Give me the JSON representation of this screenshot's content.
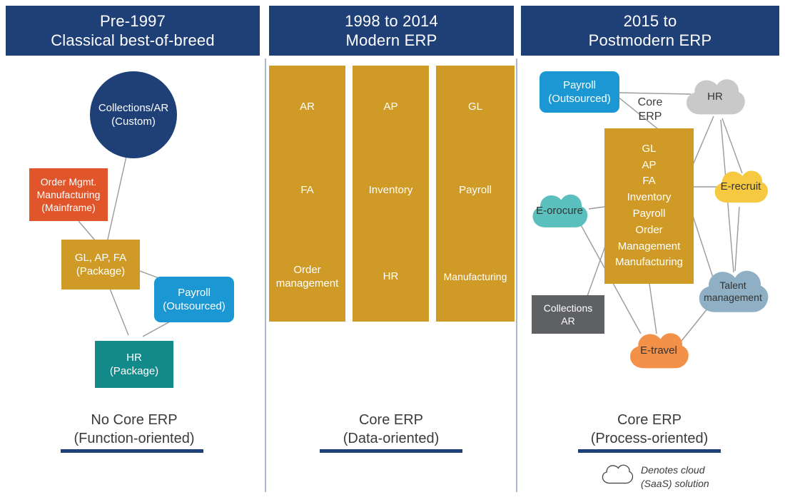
{
  "columns": [
    {
      "id": "pre-1997",
      "header": {
        "line1": "Pre-1997",
        "line2": "Classical best-of-breed"
      },
      "caption": {
        "line1": "No Core ERP",
        "line2": "(Function-oriented)"
      },
      "nodes": [
        {
          "name": "collections-ar-custom",
          "line1": "Collections/AR",
          "line2": "(Custom)",
          "color": "#1f3f77",
          "shape": "circle"
        },
        {
          "name": "order-mgmt-manufacturing-mainframe",
          "line1": "Order Mgmt.",
          "line2": "Manufacturing",
          "line3": "(Mainframe)",
          "color": "#e0562a",
          "shape": "sharp"
        },
        {
          "name": "gl-ap-fa-package",
          "line1": "GL, AP, FA",
          "line2": "(Package)",
          "color": "#cf9b26",
          "shape": "sharp"
        },
        {
          "name": "payroll-outsourced",
          "line1": "Payroll",
          "line2": "(Outsourced)",
          "color": "#1b97d4",
          "shape": "rounded"
        },
        {
          "name": "hr-package",
          "line1": "HR",
          "line2": "(Package)",
          "color": "#128a8a",
          "shape": "sharp"
        }
      ]
    },
    {
      "id": "1998-2014",
      "header": {
        "line1": "1998 to 2014",
        "line2": "Modern ERP"
      },
      "caption": {
        "line1": "Core ERP",
        "line2": "(Data-oriented)"
      },
      "tiles": [
        "AR",
        "AP",
        "GL",
        "FA",
        "Inventory",
        "Payroll",
        "Order management",
        "HR",
        "Manufacturing"
      ],
      "tile_color": "#cf9b26"
    },
    {
      "id": "2015-postmodern",
      "header": {
        "line1": "2015 to",
        "line2": "Postmodern ERP"
      },
      "caption": {
        "line1": "Core ERP",
        "line2": "(Process-oriented)"
      },
      "core_label": {
        "line1": "Core",
        "line2": "ERP"
      },
      "core_box": {
        "name": "core-erp-box",
        "color": "#cf9b26",
        "items": [
          "GL",
          "AP",
          "FA",
          "Inventory",
          "Payroll",
          "Order",
          "Management",
          "Manufacturing"
        ]
      },
      "boxes": [
        {
          "name": "payroll-outsourced",
          "line1": "Payroll",
          "line2": "(Outsourced)",
          "color": "#1b97d4",
          "shape": "rounded"
        },
        {
          "name": "collections-ar",
          "line1": "Collections",
          "line2": "AR",
          "color": "#5e6064",
          "shape": "sharp"
        }
      ],
      "clouds": [
        {
          "name": "hr-cloud",
          "line1": "HR",
          "line2": "",
          "color": "#c9c9c9"
        },
        {
          "name": "e-recruit-cloud",
          "line1": "E-recruit",
          "line2": "",
          "color": "#f6c941"
        },
        {
          "name": "e-orocure-cloud",
          "line1": "E-orocure",
          "line2": "",
          "color": "#5bbfbd"
        },
        {
          "name": "talent-management-cloud",
          "line1": "Talent",
          "line2": "management",
          "color": "#8fb0c4"
        },
        {
          "name": "e-travel-cloud",
          "line1": "E-travel",
          "line2": "",
          "color": "#f39149"
        }
      ],
      "legend": {
        "line1": "Denotes cloud",
        "line2": "(SaaS) solution"
      }
    }
  ],
  "theme": {
    "header_bg": "#1f3f77",
    "rule_color": "#1f3f77",
    "divider_color": "#aab8d4",
    "connector_color": "#9a9a9a",
    "page_bg": "#ffffff",
    "text_dark": "#3b3b3b"
  }
}
